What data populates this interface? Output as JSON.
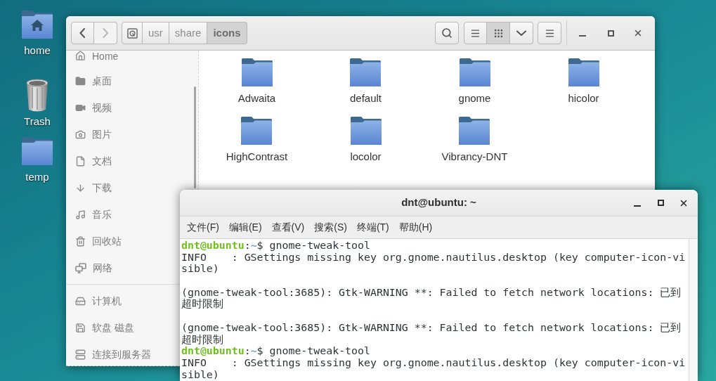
{
  "desktop": {
    "icons": [
      {
        "label": "home",
        "kind": "home",
        "selected": false
      },
      {
        "label": "Trash",
        "kind": "trash",
        "selected": false
      },
      {
        "label": "temp",
        "kind": "folder",
        "selected": false
      }
    ]
  },
  "file_manager": {
    "navigation": [
      {
        "kind": "back",
        "disabled": false
      },
      {
        "kind": "forward",
        "disabled": true
      }
    ],
    "path_bar": [
      {
        "label": "usr",
        "selected": false
      },
      {
        "label": "share",
        "selected": false
      },
      {
        "label": "icons",
        "selected": true
      }
    ],
    "view_buttons": [
      {
        "kind": "list",
        "selected": false
      },
      {
        "kind": "grid",
        "selected": true
      }
    ],
    "sidebar": {
      "sections": [
        {
          "items": [
            {
              "label": "Home",
              "kind": "home",
              "selected": false
            },
            {
              "label": "桌面",
              "kind": "desktop",
              "selected": false
            },
            {
              "label": "视频",
              "kind": "videos",
              "selected": false
            },
            {
              "label": "图片",
              "kind": "pictures",
              "selected": false
            },
            {
              "label": "文档",
              "kind": "documents",
              "selected": false
            },
            {
              "label": "下载",
              "kind": "downloads",
              "selected": false
            },
            {
              "label": "音乐",
              "kind": "music",
              "selected": false
            },
            {
              "label": "回收站",
              "kind": "trash",
              "selected": false
            },
            {
              "label": "网络",
              "kind": "network",
              "selected": false
            }
          ]
        },
        {
          "items": [
            {
              "label": "计算机",
              "kind": "computer",
              "selected": false
            },
            {
              "label": "软盘 磁盘",
              "kind": "disk",
              "selected": false
            },
            {
              "label": "连接到服务器",
              "kind": "server",
              "selected": false
            }
          ]
        }
      ]
    },
    "folders": [
      {
        "name": "Adwaita",
        "selected": false
      },
      {
        "name": "default",
        "selected": false
      },
      {
        "name": "gnome",
        "selected": false
      },
      {
        "name": "hicolor",
        "selected": false
      },
      {
        "name": "HighContrast",
        "selected": false
      },
      {
        "name": "locolor",
        "selected": false
      },
      {
        "name": "Vibrancy-DNT",
        "selected": false
      }
    ]
  },
  "terminal": {
    "title": "dnt@ubuntu: ~",
    "menu": [
      "文件(F)",
      "编辑(E)",
      "查看(V)",
      "搜索(S)",
      "终端(T)",
      "帮助(H)"
    ],
    "lines": [
      {
        "kind": "prompt",
        "user": "dnt@ubuntu",
        "separator": ":",
        "path": "~",
        "symbol": "$",
        "command": "gnome-tweak-tool"
      },
      {
        "kind": "output",
        "text": "INFO    : GSettings missing key org.gnome.nautilus.desktop (key computer-icon-vi"
      },
      {
        "kind": "output",
        "text": "sible)"
      },
      {
        "kind": "blank"
      },
      {
        "kind": "output",
        "text": "(gnome-tweak-tool:3685): Gtk-WARNING **: Failed to fetch network locations: 已到"
      },
      {
        "kind": "output",
        "text": "超时限制"
      },
      {
        "kind": "blank"
      },
      {
        "kind": "output",
        "text": "(gnome-tweak-tool:3685): Gtk-WARNING **: Failed to fetch network locations: 已到"
      },
      {
        "kind": "output",
        "text": "超时限制"
      },
      {
        "kind": "prompt",
        "user": "dnt@ubuntu",
        "separator": ":",
        "path": "~",
        "symbol": "$",
        "command": "gnome-tweak-tool"
      },
      {
        "kind": "output",
        "text": "INFO    : GSettings missing key org.gnome.nautilus.desktop (key computer-icon-vi"
      },
      {
        "kind": "output",
        "text": "sible)"
      }
    ]
  }
}
